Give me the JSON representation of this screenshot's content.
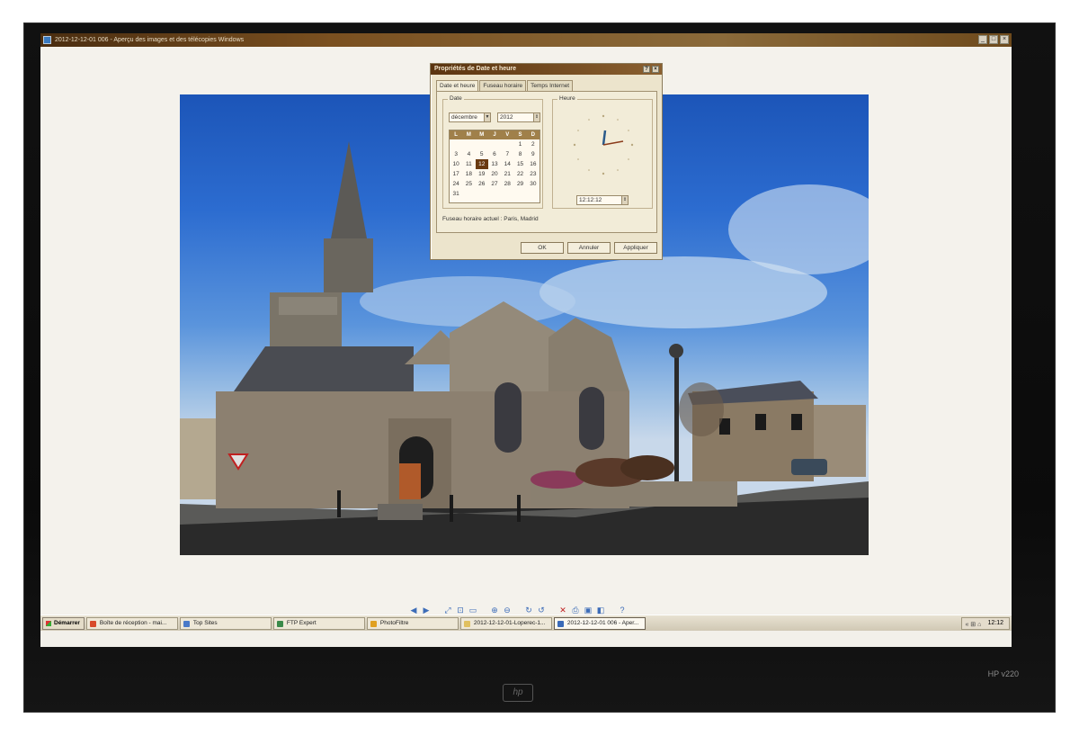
{
  "window": {
    "title": "2012-12-12-01 006 - Aperçu des images et des télécopies Windows"
  },
  "dialog": {
    "title": "Propriétés de Date et heure",
    "help_btn": "?",
    "close_btn": "×",
    "tabs": [
      "Date et heure",
      "Fuseau horaire",
      "Temps Internet"
    ],
    "date_group_label": "Date",
    "month": "décembre",
    "year": "2012",
    "weekdays": [
      "L",
      "M",
      "M",
      "J",
      "V",
      "S",
      "D"
    ],
    "days": [
      "",
      "",
      "",
      "",
      "",
      "1",
      "2",
      "3",
      "4",
      "5",
      "6",
      "7",
      "8",
      "9",
      "10",
      "11",
      "12",
      "13",
      "14",
      "15",
      "16",
      "17",
      "18",
      "19",
      "20",
      "21",
      "22",
      "23",
      "24",
      "25",
      "26",
      "27",
      "28",
      "29",
      "30",
      "31"
    ],
    "selected_day": "12",
    "time_group_label": "Heure",
    "time": "12:12:12",
    "timezone_text": "Fuseau horaire actuel : Paris, Madrid",
    "ok_label": "OK",
    "cancel_label": "Annuler",
    "apply_label": "Appliquer"
  },
  "taskbar": {
    "start_label": "Démarrer",
    "items": [
      {
        "label": "Boîte de réception - mai...",
        "color": "#d84a2a"
      },
      {
        "label": "Top Sites",
        "color": "#4a7ac8"
      },
      {
        "label": "FTP Expert",
        "color": "#3a8a4a"
      },
      {
        "label": "PhotoFiltre",
        "color": "#e0a020"
      },
      {
        "label": "2012-12-12-01-Loperec-1...",
        "color": "#e0c060"
      },
      {
        "label": "2012-12-12-01 006 - Aper...",
        "color": "#3a6ab8"
      }
    ],
    "clock": "12:12",
    "tray_icons": "« ⊞ ⌂"
  },
  "monitor": {
    "model": "HP v220",
    "logo": "hp"
  },
  "colors": {
    "sky_top": "#1c55b8",
    "titlebar": "#6e4a1c",
    "dialog_bg": "#ece4cc"
  }
}
